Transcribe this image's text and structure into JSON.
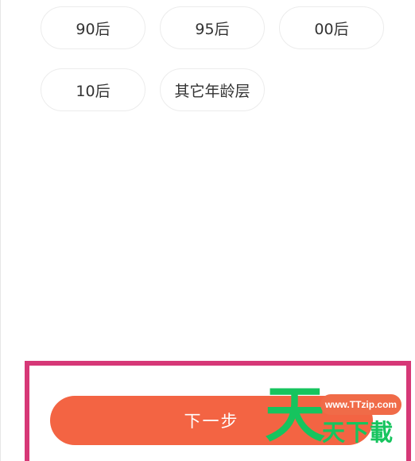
{
  "age_options": [
    "90后",
    "95后",
    "00后",
    "10后",
    "其它年龄层"
  ],
  "next_button": {
    "label": "下一步"
  },
  "watermark": {
    "big_char": "天",
    "url": "www.TTzip.com",
    "small_chars": "天下載"
  },
  "colors": {
    "button": "#f36443",
    "highlight": "#d63877",
    "watermark_green": "#16c45e",
    "watermark_pill": "#f06b48"
  }
}
